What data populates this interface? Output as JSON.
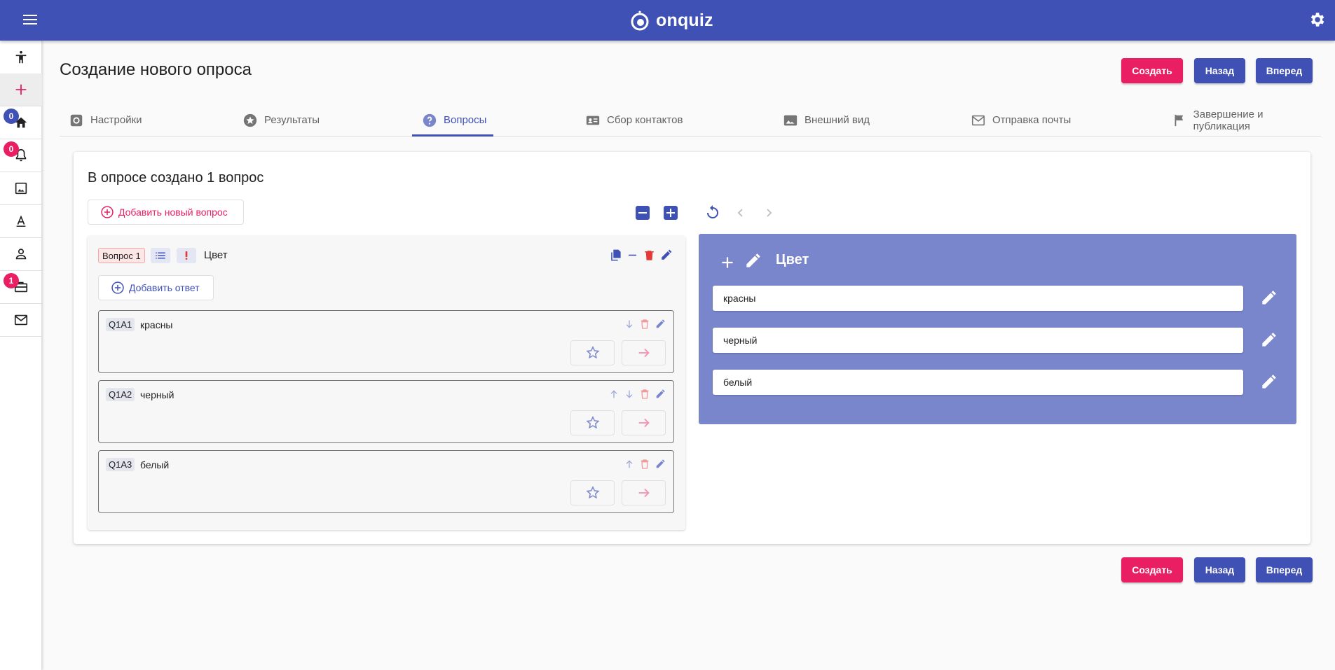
{
  "app": {
    "name": "onquiz"
  },
  "sidebar": {
    "badges": {
      "home": "0",
      "notifications": "0",
      "briefcase": "1"
    }
  },
  "page": {
    "title": "Создание нового опроса"
  },
  "buttons": {
    "create": "Создать",
    "back": "Назад",
    "forward": "Вперед"
  },
  "tabs": [
    {
      "label": "Настройки"
    },
    {
      "label": "Результаты"
    },
    {
      "label": "Вопросы"
    },
    {
      "label": "Сбор контактов"
    },
    {
      "label": "Внешний вид"
    },
    {
      "label": "Отправка почты"
    },
    {
      "label": "Завершение и публикация"
    }
  ],
  "card": {
    "title": "В опросе создано 1 вопрос",
    "add_question": "Добавить новый вопрос"
  },
  "question": {
    "chip": "Вопрос 1",
    "title": "Цвет",
    "add_answer": "Добавить ответ",
    "answers": [
      {
        "code": "Q1A1",
        "text": "красны"
      },
      {
        "code": "Q1A2",
        "text": "черный"
      },
      {
        "code": "Q1A3",
        "text": "белый"
      }
    ]
  },
  "preview": {
    "title": "Цвет",
    "options": [
      "красны",
      "черный",
      "белый"
    ]
  },
  "colors": {
    "primary": "#3f51b5",
    "accent": "#e91e63",
    "preview_bg": "#7986cb"
  }
}
